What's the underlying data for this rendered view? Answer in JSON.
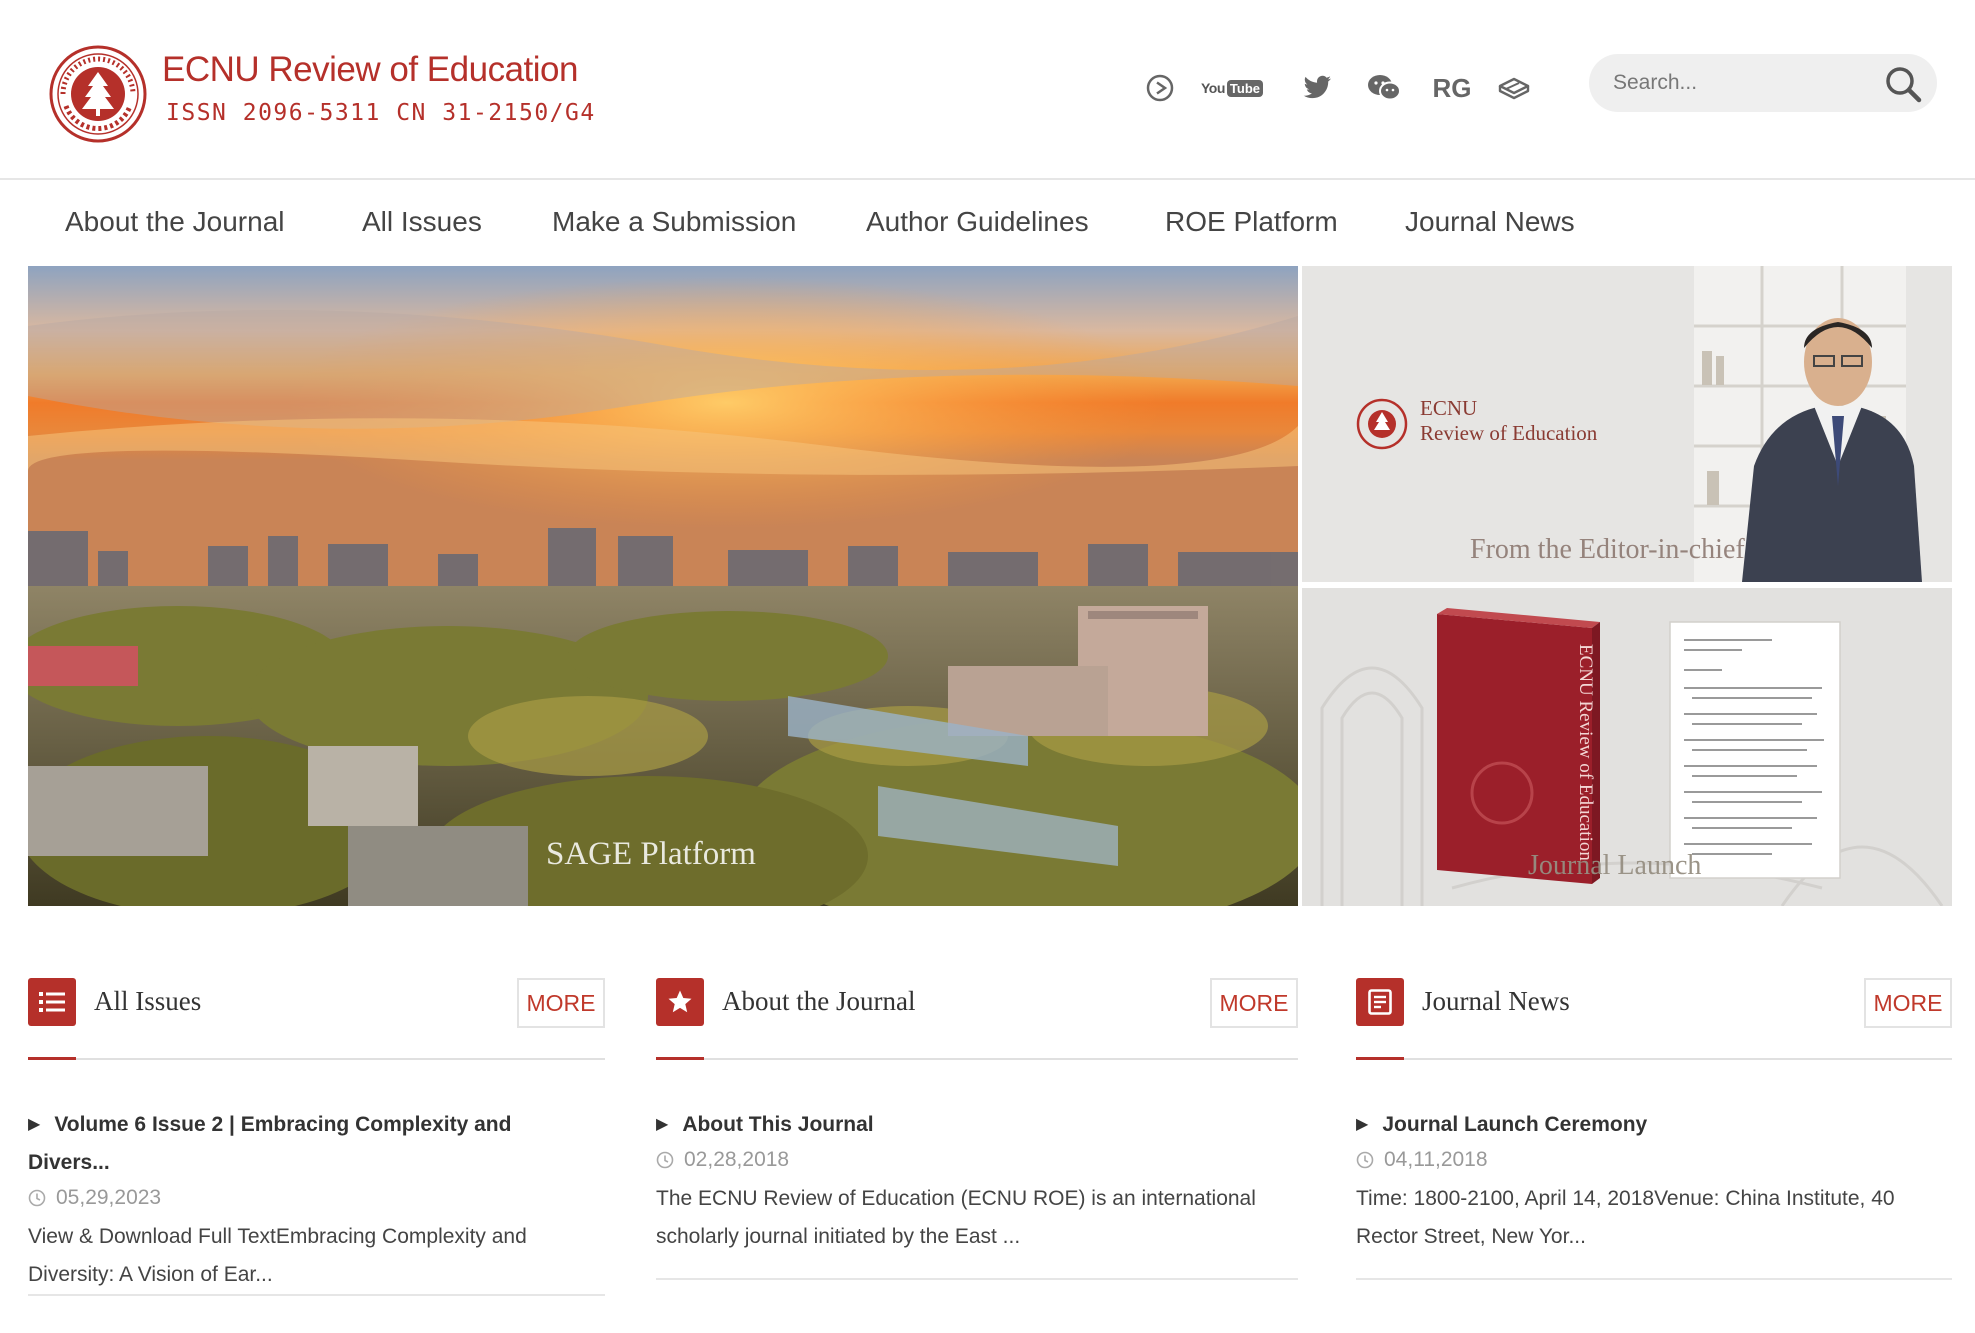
{
  "brand": {
    "title": "ECNU Review of Education",
    "issn": "ISSN 2096-5311 CN 31-2150/G4",
    "accent_color": "#b5302a"
  },
  "social_icons": [
    "play-circle-icon",
    "youtube-icon",
    "twitter-icon",
    "wechat-icon",
    "researchgate-icon",
    "book-icon"
  ],
  "social": {
    "youtube_you": "You",
    "youtube_tube": "Tube",
    "researchgate": "RG"
  },
  "search": {
    "placeholder": "Search..."
  },
  "nav": {
    "items": [
      {
        "label": "About the Journal"
      },
      {
        "label": "All Issues"
      },
      {
        "label": "Make a Submission"
      },
      {
        "label": "Author Guidelines"
      },
      {
        "label": "ROE Platform"
      },
      {
        "label": "Journal News"
      }
    ]
  },
  "banners": {
    "main_caption": "SAGE Platform",
    "editor_caption": "From the Editor-in-chief",
    "editor_logo_line1": "ECNU",
    "editor_logo_line2": "Review of Education",
    "launch_caption": "Journal Launch",
    "book_spine": "ECNU Review of Education"
  },
  "columns": [
    {
      "title": "All Issues",
      "icon": "list-icon",
      "more": "MORE",
      "item_title_line1": "Volume 6 Issue 2 | Embracing Complexity and",
      "item_title_line2": "Divers...",
      "date": "05,29,2023",
      "desc_line1": "View & Download Full TextEmbracing Complexity and",
      "desc_line2": "Diversity: A Vision of Ear..."
    },
    {
      "title": "About the Journal",
      "icon": "star-icon",
      "more": "MORE",
      "item_title_line1": "About This Journal",
      "date": "02,28,2018",
      "desc_line1": "The ECNU Review of Education (ECNU ROE) is an international",
      "desc_line2": "scholarly journal initiated by the East ..."
    },
    {
      "title": "Journal News",
      "icon": "news-icon",
      "more": "MORE",
      "item_title_line1": "Journal Launch Ceremony",
      "date": "04,11,2018",
      "desc_line1": "Time: 1800-2100, April 14, 2018Venue: China Institute, 40",
      "desc_line2": "Rector Street, New Yor..."
    }
  ]
}
